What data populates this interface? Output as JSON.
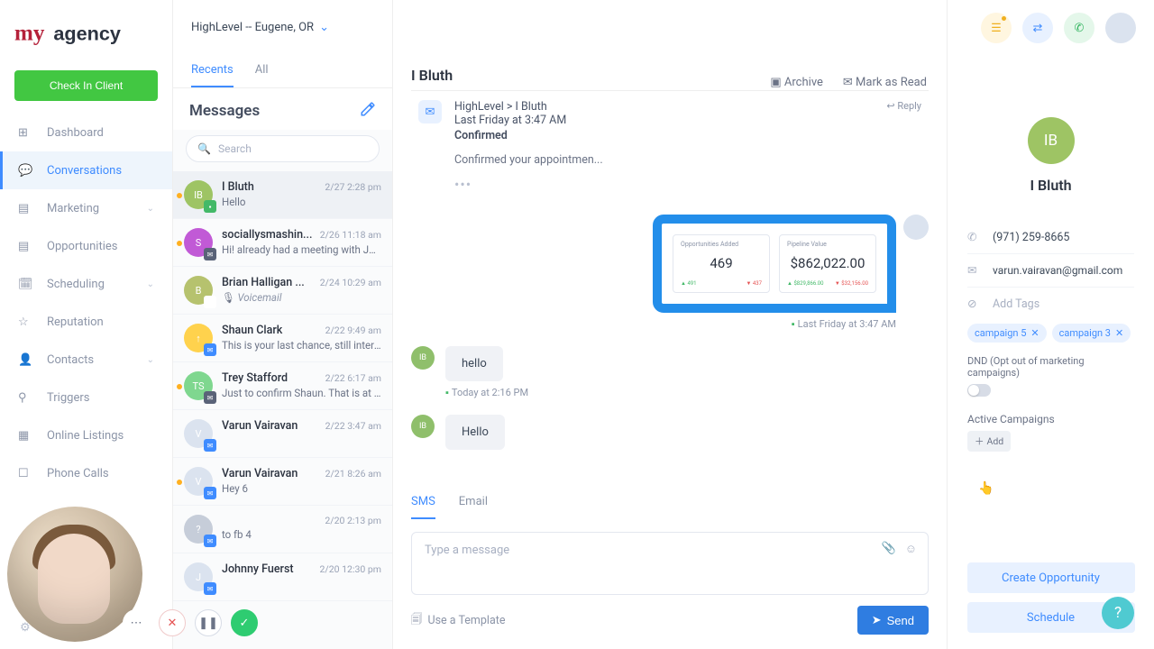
{
  "brand": {
    "full": "myagency",
    "prefix": "my",
    "suffix": "agency"
  },
  "check_in_label": "Check In Client",
  "location": "HighLevel -- Eugene, OR",
  "nav": [
    {
      "label": "Dashboard",
      "icon": "dashboard-icon"
    },
    {
      "label": "Conversations",
      "icon": "chat-icon",
      "active": true
    },
    {
      "label": "Marketing",
      "icon": "marketing-icon",
      "chev": true
    },
    {
      "label": "Opportunities",
      "icon": "opportunities-icon"
    },
    {
      "label": "Scheduling",
      "icon": "calendar-icon",
      "chev": true
    },
    {
      "label": "Reputation",
      "icon": "star-icon"
    },
    {
      "label": "Contacts",
      "icon": "contacts-icon",
      "chev": true
    },
    {
      "label": "Triggers",
      "icon": "triggers-icon"
    },
    {
      "label": "Online Listings",
      "icon": "listings-icon"
    },
    {
      "label": "Phone Calls",
      "icon": "phone-icon"
    }
  ],
  "tabs": {
    "recents": "Recents",
    "all": "All"
  },
  "messages_title": "Messages",
  "search_placeholder": "Search",
  "conversations": [
    {
      "dot": true,
      "avatar": "IB",
      "color": "#9ec464",
      "badge": "sms",
      "name": "I Bluth",
      "snippet": "Hello",
      "time": "2/27 2:28 pm"
    },
    {
      "dot": true,
      "avatar": "S",
      "color": "#c15ad6",
      "badge": "mail",
      "name": "sociallysmashin...",
      "snippet": "Hi! already had a meeting with Jos...",
      "time": "2/26 11:18 am"
    },
    {
      "dot": false,
      "avatar": "B",
      "color": "#b6c26e",
      "badge": "voice",
      "name": "Brian Halligan ...",
      "snippet": "Voicemail",
      "time": "2/24 10:29 am",
      "vm": true
    },
    {
      "dot": false,
      "avatar": "↑",
      "color": "#ffd24d",
      "badge": "blue",
      "name": "Shaun Clark",
      "snippet": "This is your last chance, still intere...",
      "time": "2/22 9:49 am"
    },
    {
      "dot": true,
      "avatar": "TS",
      "color": "#7fd78f",
      "badge": "mail",
      "name": "Trey Stafford",
      "snippet": "Just to confirm Shaun. That is at 8:...",
      "time": "2/22 6:17 am"
    },
    {
      "dot": false,
      "avatar": "V",
      "color": "#dbe3ef",
      "badge": "blue",
      "name": "Varun Vairavan",
      "snippet": "",
      "time": "2/22 3:47 am"
    },
    {
      "dot": true,
      "avatar": "V",
      "color": "#dbe3ef",
      "badge": "blue",
      "name": "Varun Vairavan",
      "snippet": "Hey 6",
      "time": "2/21 8:26 am"
    },
    {
      "dot": false,
      "avatar": "?",
      "color": "#c6cdd9",
      "badge": "blue",
      "name": "",
      "snippet": "to fb 4",
      "time": "2/20 2:13 pm"
    },
    {
      "dot": false,
      "avatar": "J",
      "color": "#dbe3ef",
      "badge": "blue",
      "name": "Johnny Fuerst",
      "snippet": "",
      "time": "2/20 12:30 pm"
    }
  ],
  "thread": {
    "title": "I Bluth",
    "actions": {
      "archive": "Archive",
      "mark_read": "Mark as Read"
    },
    "email": {
      "from": "HighLevel > I Bluth",
      "time": "Last Friday at 3:47 AM",
      "subject": "Confirmed",
      "preview": "Confirmed your appointmen...",
      "reply": "Reply"
    },
    "image_msg": {
      "stats": [
        {
          "label": "Opportunities Added",
          "value": "469",
          "l": "491",
          "r": "437"
        },
        {
          "label": "Pipeline Value",
          "value": "$862,022.00",
          "l": "$829,866.00",
          "r": "$32,156.00"
        }
      ],
      "meta": "Last Friday at 3:47 AM"
    },
    "incoming": [
      {
        "text": "hello",
        "meta": "Today at 2:16 PM"
      },
      {
        "text": "Hello",
        "meta": ""
      }
    ],
    "compose_tabs": {
      "sms": "SMS",
      "email": "Email"
    },
    "compose_placeholder": "Type a message",
    "template_label": "Use a Template",
    "send_label": "Send"
  },
  "contact": {
    "initials": "IB",
    "name": "I Bluth",
    "phone": "(971) 259-8665",
    "email": "varun.vairavan@gmail.com",
    "add_tags": "Add Tags",
    "tags": [
      "campaign 5",
      "campaign 3"
    ],
    "dnd_label": "DND (Opt out of marketing campaigns)",
    "active_campaigns": "Active Campaigns",
    "add": "Add",
    "create_opportunity": "Create Opportunity",
    "schedule": "Schedule"
  }
}
